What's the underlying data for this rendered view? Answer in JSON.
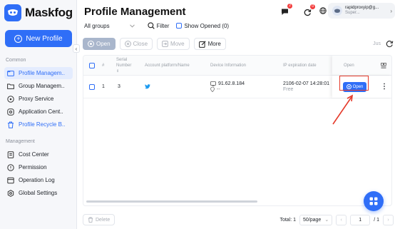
{
  "brand": {
    "name": "Maskfog"
  },
  "sidebar": {
    "new_profile": "New Profile",
    "sections": {
      "common": "Common",
      "management": "Management"
    },
    "common_items": [
      {
        "label": "Profile Managem..",
        "icon": "folder-icon"
      },
      {
        "label": "Group Managem..",
        "icon": "group-folder-icon"
      },
      {
        "label": "Proxy Service",
        "icon": "proxy-icon"
      },
      {
        "label": "Application Cent..",
        "icon": "application-icon"
      },
      {
        "label": "Profile Recycle B..",
        "icon": "trash-icon"
      }
    ],
    "management_items": [
      {
        "label": "Cost Center",
        "icon": "cost-icon"
      },
      {
        "label": "Permission",
        "icon": "permission-icon"
      },
      {
        "label": "Operation Log",
        "icon": "log-icon"
      },
      {
        "label": "Global Settings",
        "icon": "settings-icon"
      }
    ]
  },
  "header": {
    "title": "Profile Management",
    "sync_badge": "0",
    "language": "EN",
    "message_badge": "2",
    "user": {
      "email": "rapidproxyip@g...",
      "role": "Super..."
    }
  },
  "toolbar": {
    "group_select": "All groups",
    "filter": "Filter",
    "show_opened": "Show Opened (0)",
    "open": "Open",
    "close": "Close",
    "move": "Move",
    "more": "More",
    "right_text": "Jus"
  },
  "table": {
    "headers": {
      "index": "#",
      "serial": "Serial Number",
      "account": "Account platform/Name",
      "device": "Device Information",
      "expiration": "IP expiration date",
      "open": "Open"
    },
    "rows": [
      {
        "index": "1",
        "serial": "3",
        "device_ip": "91.62.8.184",
        "device_loc": "--",
        "expiration": "2106-02-07 14:28:01",
        "expiration_status": "Free",
        "open_label": "Open"
      }
    ]
  },
  "footer": {
    "delete": "Delete",
    "total": "Total: 1",
    "per_page": "50/page",
    "page": "1",
    "pages": "/ 1"
  },
  "colors": {
    "accent": "#2f6ef7",
    "highlight": "#e53a2a"
  }
}
